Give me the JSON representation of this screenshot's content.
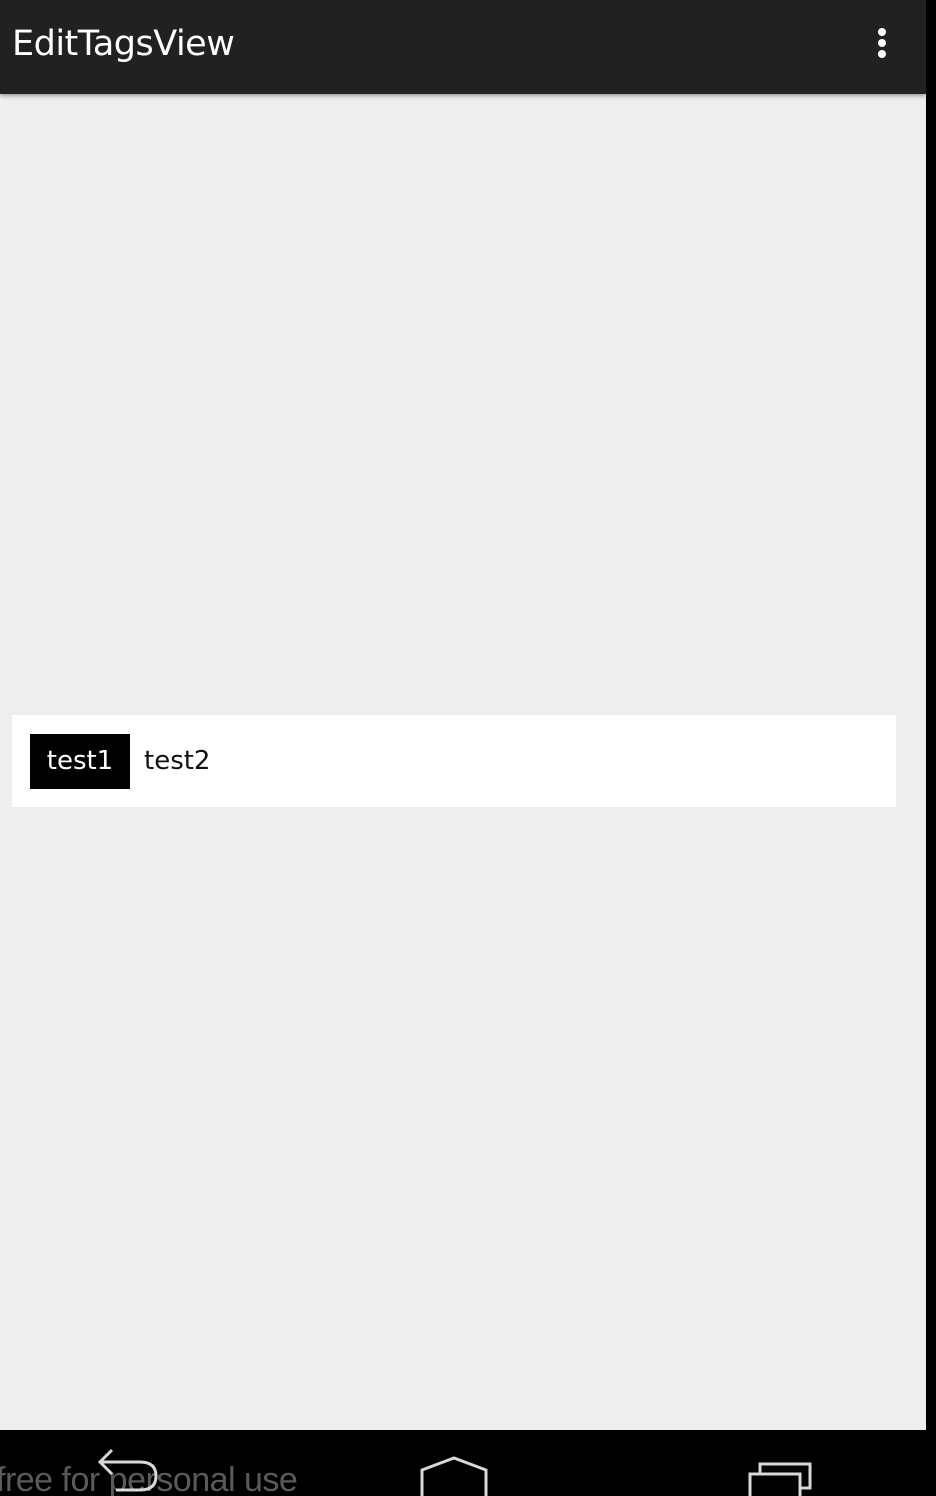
{
  "app": {
    "title": "EditTagsView"
  },
  "tags": {
    "chips": [
      "test1"
    ],
    "input_text": "test2"
  },
  "navigation": {
    "watermark": "free for personal use"
  },
  "colors": {
    "action_bar": "#212121",
    "background": "#eeeeee",
    "tags_box": "#ffffff",
    "chip_background": "#000000",
    "chip_text": "#ffffff",
    "nav_bar": "#000000"
  },
  "icons": {
    "overflow": "overflow-menu-icon",
    "back": "back-icon",
    "home": "home-icon",
    "recents": "recents-icon"
  }
}
